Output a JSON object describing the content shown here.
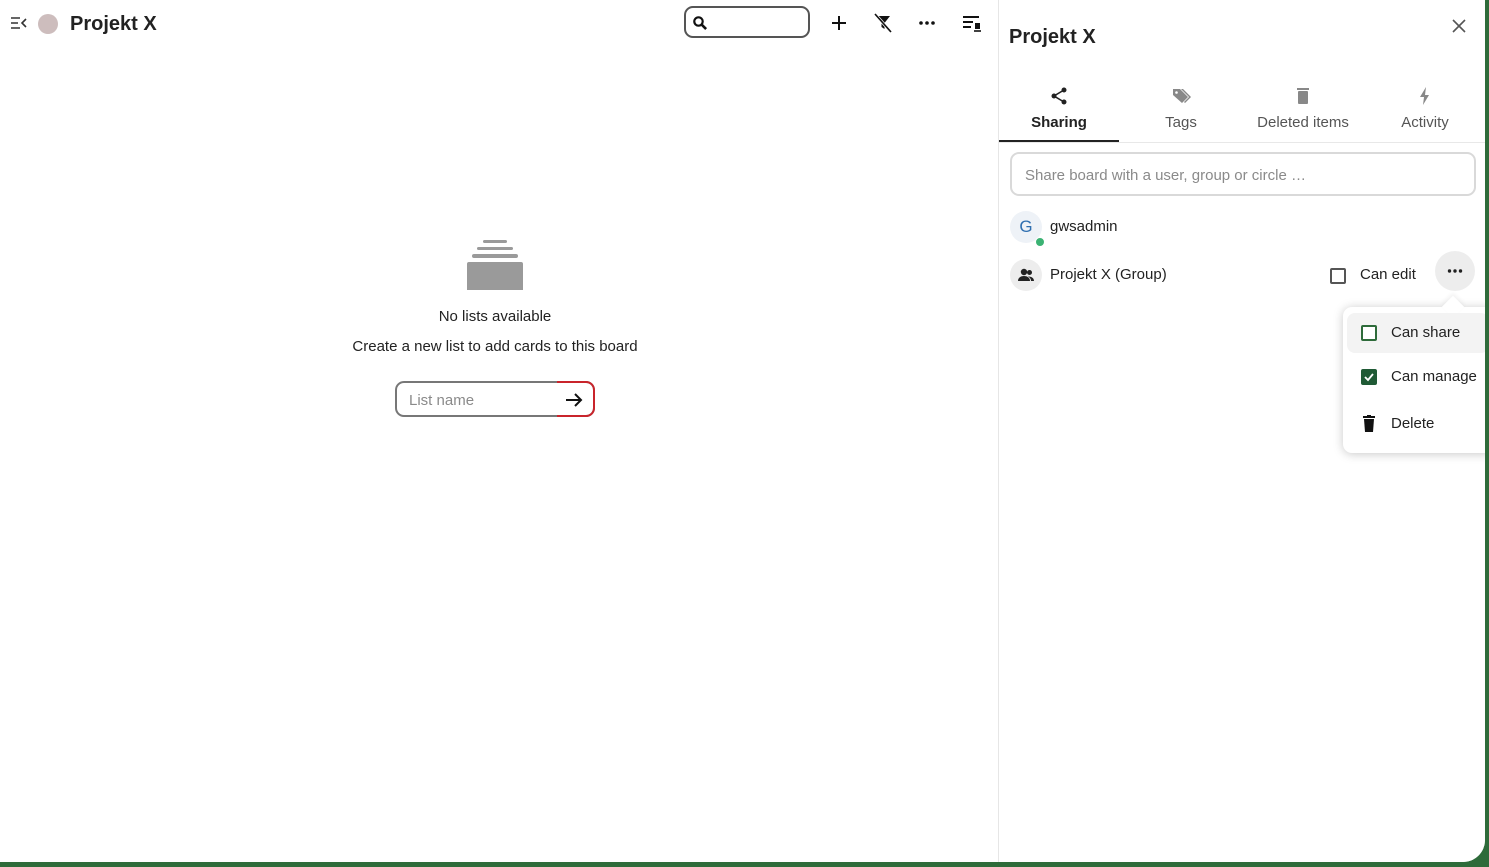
{
  "board": {
    "title": "Projekt X",
    "dot_color": "#cdbdbd"
  },
  "toolbar": {
    "search_value": "",
    "icons": [
      "search-icon",
      "plus-icon",
      "filter-off-icon",
      "dots-horizontal-icon",
      "details-toggle-icon"
    ]
  },
  "empty_state": {
    "title": "No lists available",
    "subtitle": "Create a new list to add cards to this board",
    "input_placeholder": "List name"
  },
  "sidebar": {
    "title": "Projekt X",
    "tabs": [
      {
        "label": "Sharing",
        "icon": "share-icon",
        "active": true
      },
      {
        "label": "Tags",
        "icon": "tag-icon",
        "active": false
      },
      {
        "label": "Deleted items",
        "icon": "trash-icon",
        "active": false
      },
      {
        "label": "Activity",
        "icon": "lightning-icon",
        "active": false
      }
    ],
    "share_placeholder": "Share board with a user, group or circle …",
    "shares": [
      {
        "name": "gwsadmin",
        "avatar_letter": "G",
        "status": "online"
      },
      {
        "name": "Projekt X (Group)",
        "can_edit_label": "Can edit",
        "can_edit": false
      }
    ],
    "menu": {
      "items": [
        {
          "label": "Can share",
          "checked": false
        },
        {
          "label": "Can manage",
          "checked": true
        },
        {
          "label": "Delete",
          "icon": "trash-icon"
        }
      ]
    }
  },
  "colors": {
    "accent": "#1f5a35",
    "frame": "#2e6b3a",
    "error_border": "#c9242b"
  }
}
